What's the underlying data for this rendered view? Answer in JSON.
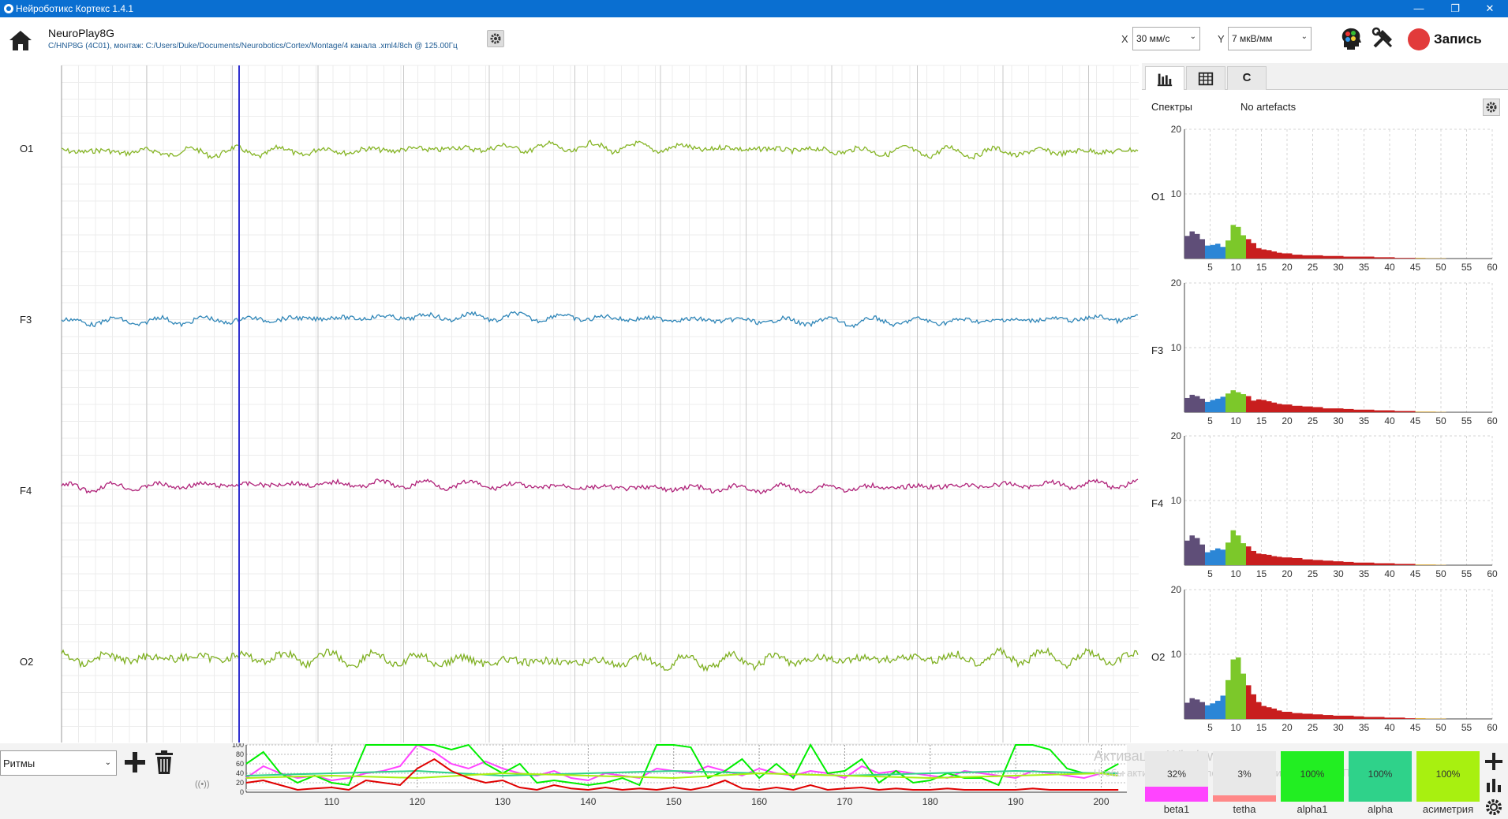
{
  "window": {
    "title": "Нейроботикс Кортекс 1.4.1",
    "minimize": "—",
    "restore": "❐",
    "close": "✕"
  },
  "toolbar": {
    "device_name": "NeuroPlay8G",
    "device_path": "C/HNP8G (4C01), монтаж: C:/Users/Duke/Documents/Neurobotics/Cortex/Montage/4 канала .xml4/8ch @ 125.00Гц",
    "x_label": "X",
    "x_value": "30 мм/с",
    "y_label": "Y",
    "y_value": "7 мкВ/мм",
    "record_label": "Запись",
    "colors": {
      "record": "#e23b3b",
      "path_text": "#1e5b93"
    }
  },
  "eeg": {
    "channels": [
      {
        "label": "O1",
        "color": "#86b526"
      },
      {
        "label": "F3",
        "color": "#2f86b8"
      },
      {
        "label": "F4",
        "color": "#b0237a"
      },
      {
        "label": "O2",
        "color": "#7fb022"
      }
    ],
    "cursor_color": "#3030d0"
  },
  "right_panel": {
    "tabs": [
      {
        "name": "bar-chart-icon",
        "label": ""
      },
      {
        "name": "table-icon",
        "label": ""
      },
      {
        "name": "c-tab",
        "label": "C"
      }
    ],
    "spectra_label": "Спектры",
    "artefacts_label": "No artefacts",
    "spectrum_charts": [
      {
        "channel": "O1",
        "y_ticks": [
          "20",
          "10"
        ],
        "x_ticks": [
          "5",
          "10",
          "15",
          "20",
          "25",
          "30",
          "35",
          "40",
          "45",
          "50",
          "55",
          "60"
        ]
      },
      {
        "channel": "F3",
        "y_ticks": [
          "20",
          "10"
        ],
        "x_ticks": [
          "5",
          "10",
          "15",
          "20",
          "25",
          "30",
          "35",
          "40",
          "45",
          "50",
          "55",
          "60"
        ]
      },
      {
        "channel": "F4",
        "y_ticks": [
          "20",
          "10"
        ],
        "x_ticks": [
          "5",
          "10",
          "15",
          "20",
          "25",
          "30",
          "35",
          "40",
          "45",
          "50",
          "55",
          "60"
        ]
      },
      {
        "channel": "O2",
        "y_ticks": [
          "20",
          "10"
        ],
        "x_ticks": [
          "5",
          "10",
          "15",
          "20",
          "25",
          "30",
          "35",
          "40",
          "45",
          "50",
          "55",
          "60"
        ]
      }
    ],
    "band_colors": {
      "delta": "#5f4e78",
      "theta": "#2b86d6",
      "alpha": "#7cc82a",
      "beta": "#c81e1e",
      "gamma": "#d8a020"
    }
  },
  "chart_data": [
    {
      "type": "bar",
      "channel": "O1",
      "xlabel": "",
      "ylabel": "",
      "ylim": [
        0,
        20
      ],
      "xlim": [
        0,
        60
      ],
      "x": [
        1,
        2,
        3,
        4,
        5,
        6,
        7,
        8,
        9,
        10,
        11,
        12,
        13,
        14,
        15,
        16,
        17,
        18,
        19,
        20,
        22,
        24,
        26,
        28,
        30,
        32,
        34,
        36,
        38,
        40,
        42,
        44,
        46,
        48,
        50
      ],
      "values": [
        3.5,
        4.2,
        3.8,
        3.0,
        2.0,
        2.1,
        2.3,
        1.8,
        2.8,
        5.2,
        4.9,
        3.6,
        3.0,
        2.4,
        1.6,
        1.4,
        1.3,
        1.1,
        0.9,
        0.8,
        0.6,
        0.5,
        0.5,
        0.4,
        0.4,
        0.3,
        0.3,
        0.3,
        0.2,
        0.2,
        0.1,
        0.1,
        0.1,
        0.05,
        0.05
      ]
    },
    {
      "type": "bar",
      "channel": "F3",
      "xlabel": "",
      "ylabel": "",
      "ylim": [
        0,
        20
      ],
      "xlim": [
        0,
        60
      ],
      "x": [
        1,
        2,
        3,
        4,
        5,
        6,
        7,
        8,
        9,
        10,
        11,
        12,
        13,
        14,
        15,
        16,
        17,
        18,
        19,
        20,
        22,
        24,
        26,
        28,
        30,
        32,
        34,
        36,
        38,
        40,
        42,
        44,
        46,
        48,
        50
      ],
      "values": [
        2.2,
        2.7,
        2.5,
        2.1,
        1.6,
        1.9,
        2.1,
        2.4,
        2.9,
        3.4,
        3.1,
        2.8,
        2.5,
        1.8,
        2.0,
        1.9,
        1.7,
        1.5,
        1.3,
        1.2,
        1.0,
        0.9,
        0.8,
        0.6,
        0.6,
        0.5,
        0.4,
        0.4,
        0.3,
        0.3,
        0.2,
        0.2,
        0.1,
        0.1,
        0.05
      ]
    },
    {
      "type": "bar",
      "channel": "F4",
      "xlabel": "",
      "ylabel": "",
      "ylim": [
        0,
        20
      ],
      "xlim": [
        0,
        60
      ],
      "x": [
        1,
        2,
        3,
        4,
        5,
        6,
        7,
        8,
        9,
        10,
        11,
        12,
        13,
        14,
        15,
        16,
        17,
        18,
        19,
        20,
        22,
        24,
        26,
        28,
        30,
        32,
        34,
        36,
        38,
        40,
        42,
        44,
        46,
        48,
        50
      ],
      "values": [
        3.8,
        4.6,
        4.2,
        3.2,
        2.0,
        2.3,
        2.6,
        2.4,
        3.5,
        5.4,
        4.6,
        3.4,
        2.9,
        2.2,
        1.8,
        1.7,
        1.6,
        1.4,
        1.3,
        1.2,
        1.1,
        0.9,
        0.8,
        0.7,
        0.6,
        0.5,
        0.4,
        0.4,
        0.3,
        0.3,
        0.2,
        0.2,
        0.1,
        0.1,
        0.05
      ]
    },
    {
      "type": "bar",
      "channel": "O2",
      "xlabel": "",
      "ylabel": "",
      "ylim": [
        0,
        20
      ],
      "xlim": [
        0,
        60
      ],
      "x": [
        1,
        2,
        3,
        4,
        5,
        6,
        7,
        8,
        9,
        10,
        11,
        12,
        13,
        14,
        15,
        16,
        17,
        18,
        19,
        20,
        22,
        24,
        26,
        28,
        30,
        32,
        34,
        36,
        38,
        40,
        42,
        44,
        46,
        48,
        50
      ],
      "values": [
        2.5,
        3.2,
        3.0,
        2.6,
        2.1,
        2.4,
        2.8,
        3.6,
        6.0,
        9.2,
        9.5,
        7.0,
        5.2,
        3.8,
        2.6,
        2.0,
        1.8,
        1.6,
        1.3,
        1.1,
        0.9,
        0.8,
        0.7,
        0.6,
        0.5,
        0.5,
        0.4,
        0.3,
        0.3,
        0.2,
        0.2,
        0.1,
        0.1,
        0.05,
        0.05
      ]
    },
    {
      "type": "line",
      "name": "rhythms",
      "xlabel": "",
      "ylabel": "",
      "ylim": [
        0,
        100
      ],
      "xlim": [
        100,
        203
      ],
      "x_ticks": [
        "110",
        "120",
        "130",
        "140",
        "150",
        "160",
        "170",
        "180",
        "190",
        "200"
      ],
      "y_ticks": [
        "100",
        "80",
        "60",
        "40",
        "20",
        "0"
      ],
      "series": [
        {
          "color": "#ff44ff",
          "x": [
            100,
            102,
            104,
            106,
            108,
            110,
            112,
            114,
            116,
            118,
            120,
            122,
            124,
            126,
            128,
            130,
            132,
            134,
            136,
            138,
            140,
            142,
            144,
            146,
            148,
            150,
            152,
            154,
            156,
            158,
            160,
            162,
            164,
            166,
            168,
            170,
            172,
            174,
            176,
            178,
            180,
            182,
            184,
            186,
            188,
            190,
            192,
            194,
            196,
            198,
            200,
            202
          ],
          "values": [
            30,
            55,
            40,
            30,
            35,
            25,
            30,
            40,
            45,
            55,
            100,
            85,
            60,
            50,
            65,
            50,
            40,
            35,
            45,
            30,
            25,
            40,
            35,
            30,
            50,
            45,
            40,
            55,
            45,
            35,
            50,
            40,
            35,
            45,
            40,
            30,
            55,
            40,
            45,
            40,
            35,
            30,
            45,
            40,
            35,
            30,
            45,
            40,
            35,
            30,
            40,
            35
          ]
        },
        {
          "color": "#e8e8e8",
          "x": [
            100,
            110,
            120,
            130,
            140,
            150,
            160,
            170,
            180,
            190,
            200,
            202
          ],
          "values": [
            5,
            5,
            5,
            5,
            5,
            5,
            5,
            5,
            5,
            5,
            5,
            5
          ]
        },
        {
          "color": "#00ee00",
          "x": [
            100,
            102,
            104,
            106,
            108,
            110,
            112,
            114,
            116,
            118,
            120,
            122,
            124,
            126,
            128,
            130,
            132,
            134,
            136,
            138,
            140,
            142,
            144,
            146,
            148,
            150,
            152,
            154,
            156,
            158,
            160,
            162,
            164,
            166,
            168,
            170,
            172,
            174,
            176,
            178,
            180,
            182,
            184,
            186,
            188,
            190,
            192,
            194,
            196,
            198,
            200,
            202
          ],
          "values": [
            60,
            85,
            40,
            20,
            35,
            20,
            15,
            100,
            100,
            100,
            100,
            100,
            90,
            100,
            60,
            40,
            60,
            20,
            25,
            20,
            15,
            20,
            30,
            15,
            100,
            100,
            95,
            30,
            45,
            70,
            30,
            60,
            30,
            100,
            40,
            45,
            70,
            20,
            45,
            20,
            25,
            40,
            30,
            30,
            15,
            100,
            100,
            90,
            50,
            40,
            40,
            60
          ]
        },
        {
          "color": "#2fd28a",
          "x": [
            100,
            110,
            120,
            130,
            140,
            150,
            160,
            170,
            180,
            190,
            200,
            202
          ],
          "values": [
            35,
            40,
            45,
            35,
            40,
            45,
            40,
            35,
            40,
            45,
            40,
            40
          ]
        },
        {
          "color": "#a8f010",
          "x": [
            100,
            110,
            120,
            130,
            140,
            150,
            160,
            170,
            180,
            190,
            200,
            202
          ],
          "values": [
            30,
            35,
            30,
            40,
            35,
            30,
            40,
            35,
            30,
            35,
            40,
            35
          ]
        },
        {
          "color": "#e00000",
          "x": [
            100,
            102,
            104,
            106,
            108,
            110,
            112,
            114,
            116,
            118,
            120,
            122,
            124,
            126,
            128,
            130,
            132,
            134,
            136,
            138,
            140,
            142,
            144,
            146,
            148,
            150,
            152,
            154,
            156,
            158,
            160,
            162,
            164,
            166,
            168,
            170,
            172,
            174,
            176,
            178,
            180,
            182,
            184,
            186,
            188,
            190,
            192,
            194,
            196,
            198,
            200,
            202
          ],
          "values": [
            20,
            25,
            15,
            5,
            8,
            10,
            5,
            25,
            20,
            15,
            50,
            70,
            45,
            30,
            20,
            25,
            10,
            5,
            15,
            8,
            5,
            10,
            5,
            8,
            5,
            10,
            5,
            12,
            25,
            8,
            5,
            10,
            5,
            15,
            5,
            8,
            10,
            5,
            8,
            5,
            5,
            8,
            5,
            5,
            5,
            5,
            8,
            5,
            5,
            5,
            5,
            5
          ]
        }
      ]
    }
  ],
  "bottom": {
    "select_value": "Ритмы",
    "watermark_title": "Активация Windows",
    "watermark_sub": "Чтобы активировать Windows, перейдите в раздел \"Параметры\".",
    "indicators": [
      {
        "name": "beta1",
        "pct": "32%",
        "level": 0.32,
        "color": "#ff44ff",
        "bg": "#e8e8e8"
      },
      {
        "name": "tetha",
        "pct": "3%",
        "level": 0.03,
        "color": "#ff8888",
        "bg": "#e8e8e8"
      },
      {
        "name": "alpha1",
        "pct": "100%",
        "level": 1.0,
        "color": "#22ee22",
        "bg": "#22ee22"
      },
      {
        "name": "alpha",
        "pct": "100%",
        "level": 1.0,
        "color": "#2fd28a",
        "bg": "#2fd28a"
      },
      {
        "name": "асиметрия",
        "pct": "100%",
        "level": 1.0,
        "color": "#a8f010",
        "bg": "#a8f010"
      }
    ]
  }
}
